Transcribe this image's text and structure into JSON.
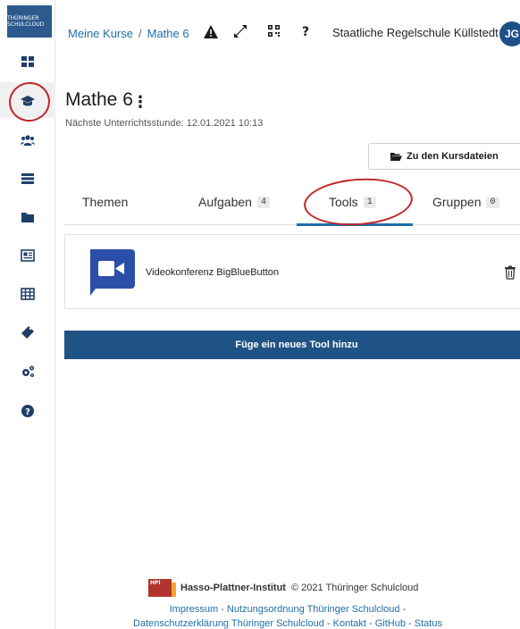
{
  "sidebar": {
    "logo_text": "THÜRINGER SCHULCLOUD",
    "items": [
      {
        "name": "dashboard",
        "icon": "grid-icon"
      },
      {
        "name": "courses",
        "icon": "graduation-cap-icon"
      },
      {
        "name": "teams",
        "icon": "users-icon"
      },
      {
        "name": "tasks",
        "icon": "list-icon"
      },
      {
        "name": "files",
        "icon": "folder-icon"
      },
      {
        "name": "news",
        "icon": "newspaper-icon"
      },
      {
        "name": "calendar",
        "icon": "table-icon"
      },
      {
        "name": "add-ons",
        "icon": "puzzle-icon"
      },
      {
        "name": "administration",
        "icon": "cogs-icon"
      },
      {
        "name": "help",
        "icon": "help-icon"
      }
    ]
  },
  "header": {
    "breadcrumb_root": "Meine Kurse",
    "breadcrumb_sep": "/",
    "breadcrumb_current": "Mathe 6",
    "school": "Staatliche Regelschule Küllstedt",
    "avatar_initials": "JG"
  },
  "course": {
    "title": "Mathe 6",
    "menu_glyph": "⋮",
    "next_lesson": "Nächste Unterrichtsstunde: 12.01.2021 10:13",
    "files_button": "Zu den Kursdateien"
  },
  "tabs": [
    {
      "label": "Themen",
      "count": ""
    },
    {
      "label": "Aufgaben",
      "count": "4"
    },
    {
      "label": "Tools",
      "count": "1"
    },
    {
      "label": "Gruppen",
      "count": "0"
    }
  ],
  "tool": {
    "name": "Videokonferenz BigBlueButton"
  },
  "add_button": "Füge ein neues Tool hinzu",
  "footer": {
    "hpi_badge": "HPI",
    "hpi_name": "Hasso-Plattner-Institut",
    "copyright": "© 2021 Thüringer Schulcloud",
    "line1": [
      "Impressum",
      "Nutzungsordnung Thüringer Schulcloud"
    ],
    "line2": [
      "Datenschutzerklärung Thüringer Schulcloud",
      "Kontakt",
      "GitHub",
      "Status"
    ]
  },
  "colors": {
    "primary": "#1f5385",
    "link": "#1f6ea8",
    "annotation_red": "#c0262b"
  }
}
